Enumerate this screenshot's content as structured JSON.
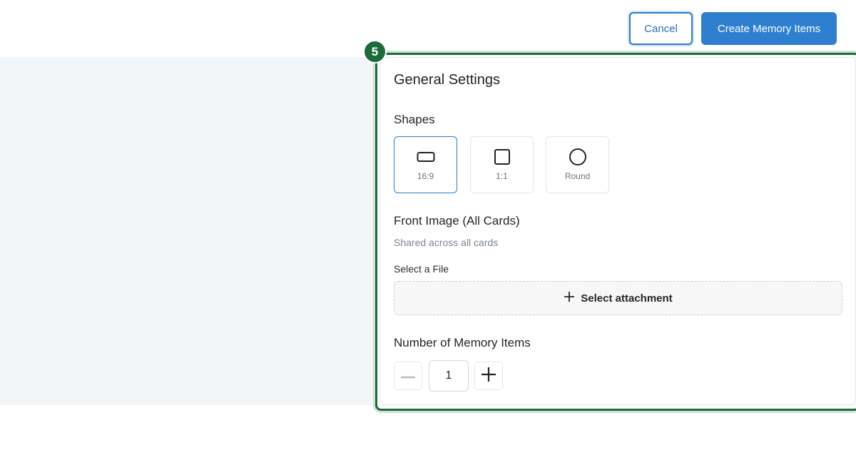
{
  "header": {
    "cancel_label": "Cancel",
    "create_label": "Create Memory Items"
  },
  "step": {
    "number": "5"
  },
  "settings": {
    "title": "General Settings",
    "shapes_label": "Shapes",
    "shapes": [
      {
        "label": "16:9",
        "icon": "rectangle-icon",
        "selected": true
      },
      {
        "label": "1:1",
        "icon": "square-icon",
        "selected": false
      },
      {
        "label": "Round",
        "icon": "circle-icon",
        "selected": false
      }
    ],
    "front_image_label": "Front Image (All Cards)",
    "front_image_sub": "Shared across all cards",
    "select_file_label": "Select a File",
    "attach_label": "Select attachment",
    "count_label": "Number of Memory Items",
    "count_value": "1"
  },
  "colors": {
    "accent": "#2f7fd0",
    "highlight": "#1c6b3a",
    "panel_bg": "#f3f6f9"
  }
}
